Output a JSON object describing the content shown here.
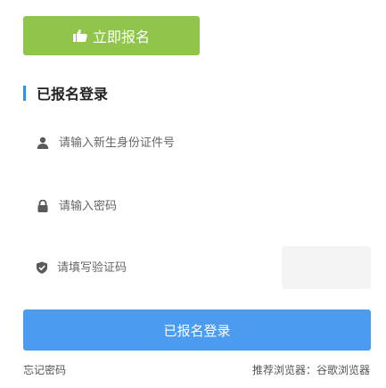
{
  "register_button": {
    "label": "立即报名",
    "icon": "thumbs-up-icon",
    "color": "#8fc54a"
  },
  "login_section": {
    "title": "已报名登录",
    "accent_color": "#3b8fd9"
  },
  "fields": {
    "id_number": {
      "placeholder": "请输入新生身份证件号",
      "value": "",
      "icon": "user-icon"
    },
    "password": {
      "placeholder": "请输入密码",
      "value": "",
      "icon": "lock-icon"
    },
    "verification_code": {
      "placeholder": "请填写验证码",
      "value": "",
      "icon": "shield-check-icon"
    }
  },
  "login_button": {
    "label": "已报名登录",
    "color": "#4b9bf0"
  },
  "footer": {
    "forgot_password": "忘记密码",
    "browser_prefix": "推荐浏览器：",
    "browser_name": "谷歌浏览器"
  }
}
